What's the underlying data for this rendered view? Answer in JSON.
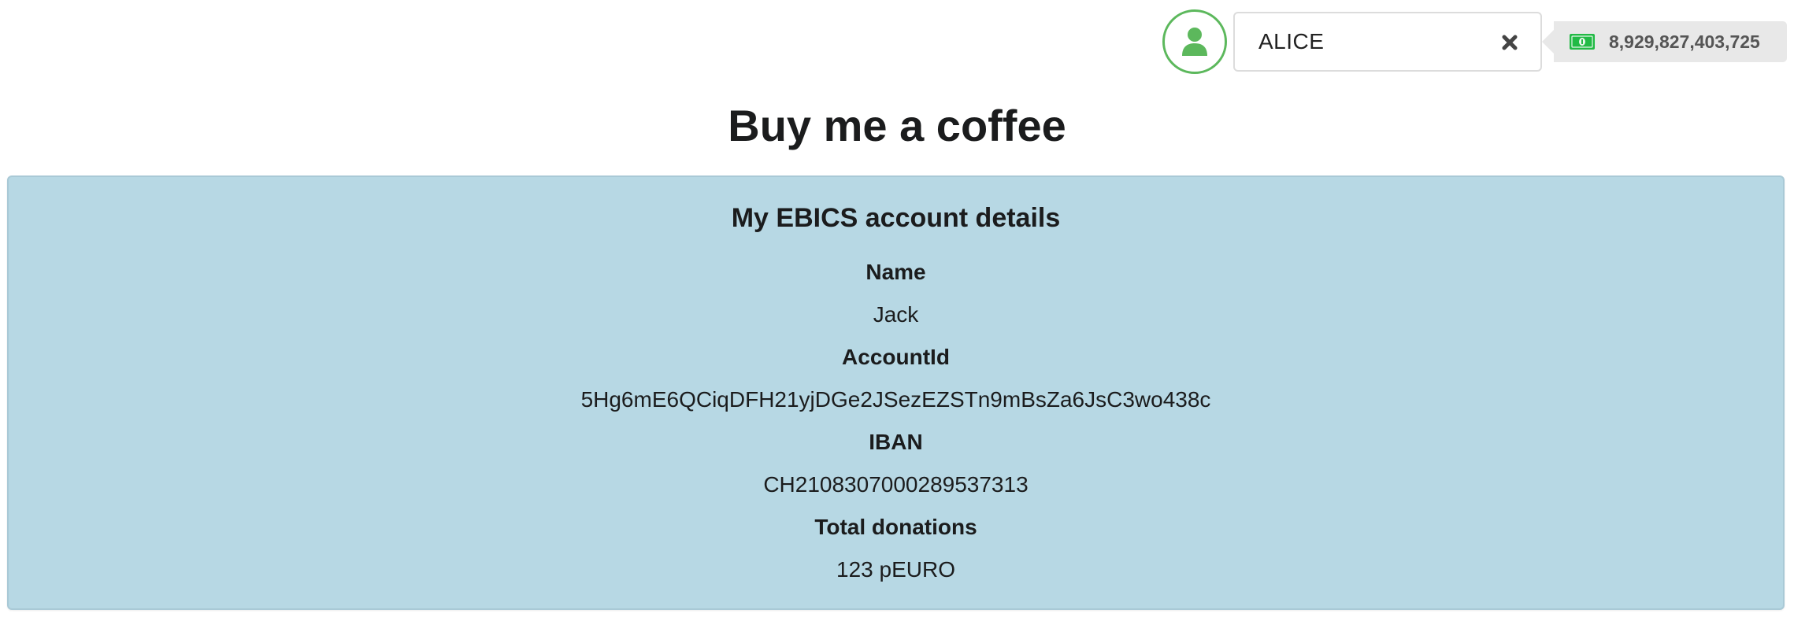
{
  "header": {
    "account_select": {
      "value": "ALICE",
      "clear_icon": "close-icon"
    },
    "avatar_icon": "user-icon",
    "balance": {
      "icon": "money-bill-icon",
      "amount": "8,929,827,403,725"
    }
  },
  "page": {
    "title": "Buy me a coffee"
  },
  "account_details": {
    "heading": "My EBICS account details",
    "fields": [
      {
        "label": "Name",
        "value": "Jack"
      },
      {
        "label": "AccountId",
        "value": "5Hg6mE6QCiqDFH21yjDGe2JSezEZSTn9mBsZa6JsC3wo438c"
      },
      {
        "label": "IBAN",
        "value": "CH2108307000289537313"
      },
      {
        "label": "Total donations",
        "value": "123 pEURO"
      }
    ]
  },
  "colors": {
    "avatar_green": "#5cb85c",
    "panel_background": "#b7d8e4",
    "tag_background": "#e8e8e8",
    "money_green": "#21ba45"
  }
}
